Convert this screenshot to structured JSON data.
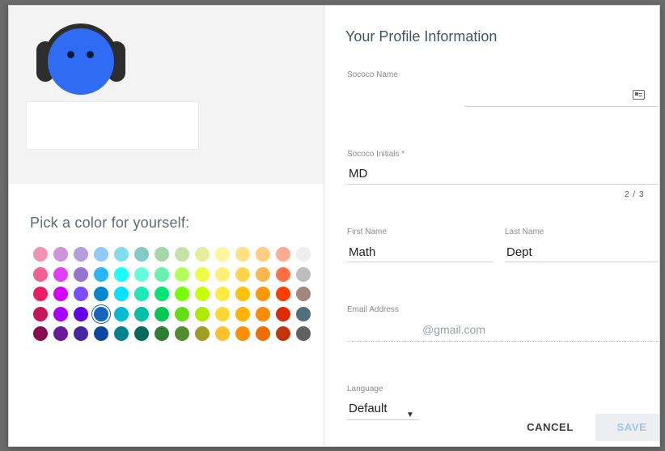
{
  "left_panel": {
    "pick_color_label": "Pick a color for yourself:",
    "palette": [
      [
        "#f194b4",
        "#ce93d8",
        "#b39ddb",
        "#90caf9",
        "#80deea",
        "#80cbc4",
        "#a5d6a7",
        "#c5e1a5",
        "#e6ee9c",
        "#fff59d",
        "#ffe082",
        "#ffcc80",
        "#ffab91",
        "#eeeeee"
      ],
      [
        "#f06292",
        "#e040fb",
        "#9575cd",
        "#29b6f6",
        "#18ffff",
        "#64ffda",
        "#69f0ae",
        "#b2ff59",
        "#eeff41",
        "#fff176",
        "#ffd54f",
        "#ffb74d",
        "#ff7043",
        "#bdbdbd"
      ],
      [
        "#e91e63",
        "#d500f9",
        "#7c4dff",
        "#0288d1",
        "#00e5ff",
        "#1de9b6",
        "#00e676",
        "#76ff03",
        "#c6ff00",
        "#ffeb3b",
        "#ffc107",
        "#ff9800",
        "#ff3d00",
        "#a1887f"
      ],
      [
        "#c2185b",
        "#aa00ff",
        "#6200ea",
        "#1565c0",
        "#00bcd4",
        "#00bfa5",
        "#00c853",
        "#64dd17",
        "#aeea00",
        "#fdd835",
        "#ffb300",
        "#fb8c00",
        "#dd2c00",
        "#546e7a"
      ],
      [
        "#880e4f",
        "#6a1b9a",
        "#4527a0",
        "#0d47a1",
        "#00838f",
        "#00695c",
        "#2e7d32",
        "#558b2f",
        "#9e9d24",
        "#fbc02d",
        "#ff8f00",
        "#ef6c00",
        "#bf360c",
        "#616161"
      ]
    ],
    "selected_color": "#1565c0"
  },
  "profile": {
    "title": "Your Profile Information",
    "sococo_name_label": "Sococo Name",
    "sococo_name_value": "",
    "initials_label": "Sococo Initials *",
    "initials_value": "MD",
    "initials_counter": "2 / 3",
    "first_name_label": "First Name",
    "first_name_value": "Math",
    "last_name_label": "Last Name",
    "last_name_value": "Dept",
    "email_label": "Email Address",
    "email_value": "@gmail.com",
    "language_label": "Language",
    "language_value": "Default",
    "cancel_label": "CANCEL",
    "save_label": "SAVE"
  }
}
